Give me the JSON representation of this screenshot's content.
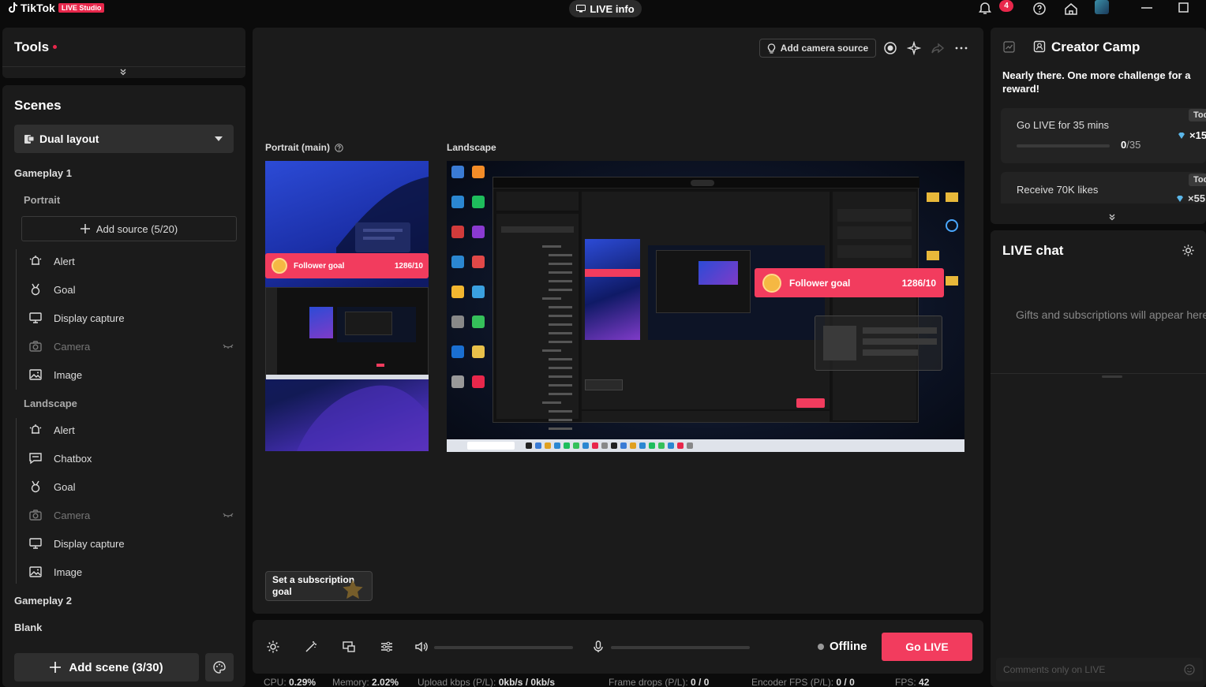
{
  "titlebar": {
    "brand": "TikTok",
    "badge": "LIVE Studio",
    "live_info": "LIVE info",
    "notification_count": "4"
  },
  "tools": {
    "title": "Tools"
  },
  "scenes": {
    "title": "Scenes",
    "layout_select": "Dual layout",
    "gameplay1": "Gameplay 1",
    "portrait": "Portrait",
    "add_source": "Add source (5/20)",
    "portrait_sources": [
      {
        "label": "Alert",
        "icon": "alert-icon"
      },
      {
        "label": "Goal",
        "icon": "goal-icon"
      },
      {
        "label": "Display capture",
        "icon": "display-icon"
      },
      {
        "label": "Camera",
        "icon": "camera-icon"
      },
      {
        "label": "Image",
        "icon": "image-icon"
      }
    ],
    "landscape": "Landscape",
    "landscape_sources": [
      {
        "label": "Alert",
        "icon": "alert-icon"
      },
      {
        "label": "Chatbox",
        "icon": "chat-icon"
      },
      {
        "label": "Goal",
        "icon": "goal-icon"
      },
      {
        "label": "Camera",
        "icon": "camera-icon"
      },
      {
        "label": "Display capture",
        "icon": "display-icon"
      },
      {
        "label": "Image",
        "icon": "image-icon"
      }
    ],
    "gameplay2": "Gameplay 2",
    "blank": "Blank",
    "add_scene": "Add scene (3/30)"
  },
  "preview": {
    "add_camera": "Add camera source",
    "portrait_label": "Portrait (main)",
    "landscape_label": "Landscape",
    "follower_goal_label": "Follower goal",
    "follower_goal_value": "1286/10",
    "subscription_goal": "Set a subscription goal"
  },
  "controls": {
    "status": "Offline",
    "go_live": "Go LIVE"
  },
  "stats": {
    "cpu_label": "CPU:",
    "cpu": "0.29%",
    "memory_label": "Memory:",
    "memory": "2.02%",
    "upload_label": "Upload kbps (P/L):",
    "upload": "0kb/s / 0kb/s",
    "drops_label": "Frame drops (P/L):",
    "drops": "0 / 0",
    "encoder_label": "Encoder FPS (P/L):",
    "encoder": "0 / 0",
    "fps_label": "FPS:",
    "fps": "42"
  },
  "camp": {
    "title": "Creator Camp",
    "subtitle": "Nearly there. One more challenge for a reward!",
    "challenges": [
      {
        "title": "Go LIVE for 35 mins",
        "progress": "0",
        "total": "/35",
        "tag": "Toc",
        "reward": "×15",
        "fraction": 0
      },
      {
        "title": "Receive 70K likes",
        "tag": "Toc",
        "reward": "×55"
      }
    ]
  },
  "chat": {
    "title": "LIVE chat",
    "empty": "Gifts and subscriptions will appear here",
    "input_placeholder": "Comments only on LIVE"
  },
  "colors": {
    "accent": "#f23c5e",
    "panel": "#1b1b1b"
  }
}
